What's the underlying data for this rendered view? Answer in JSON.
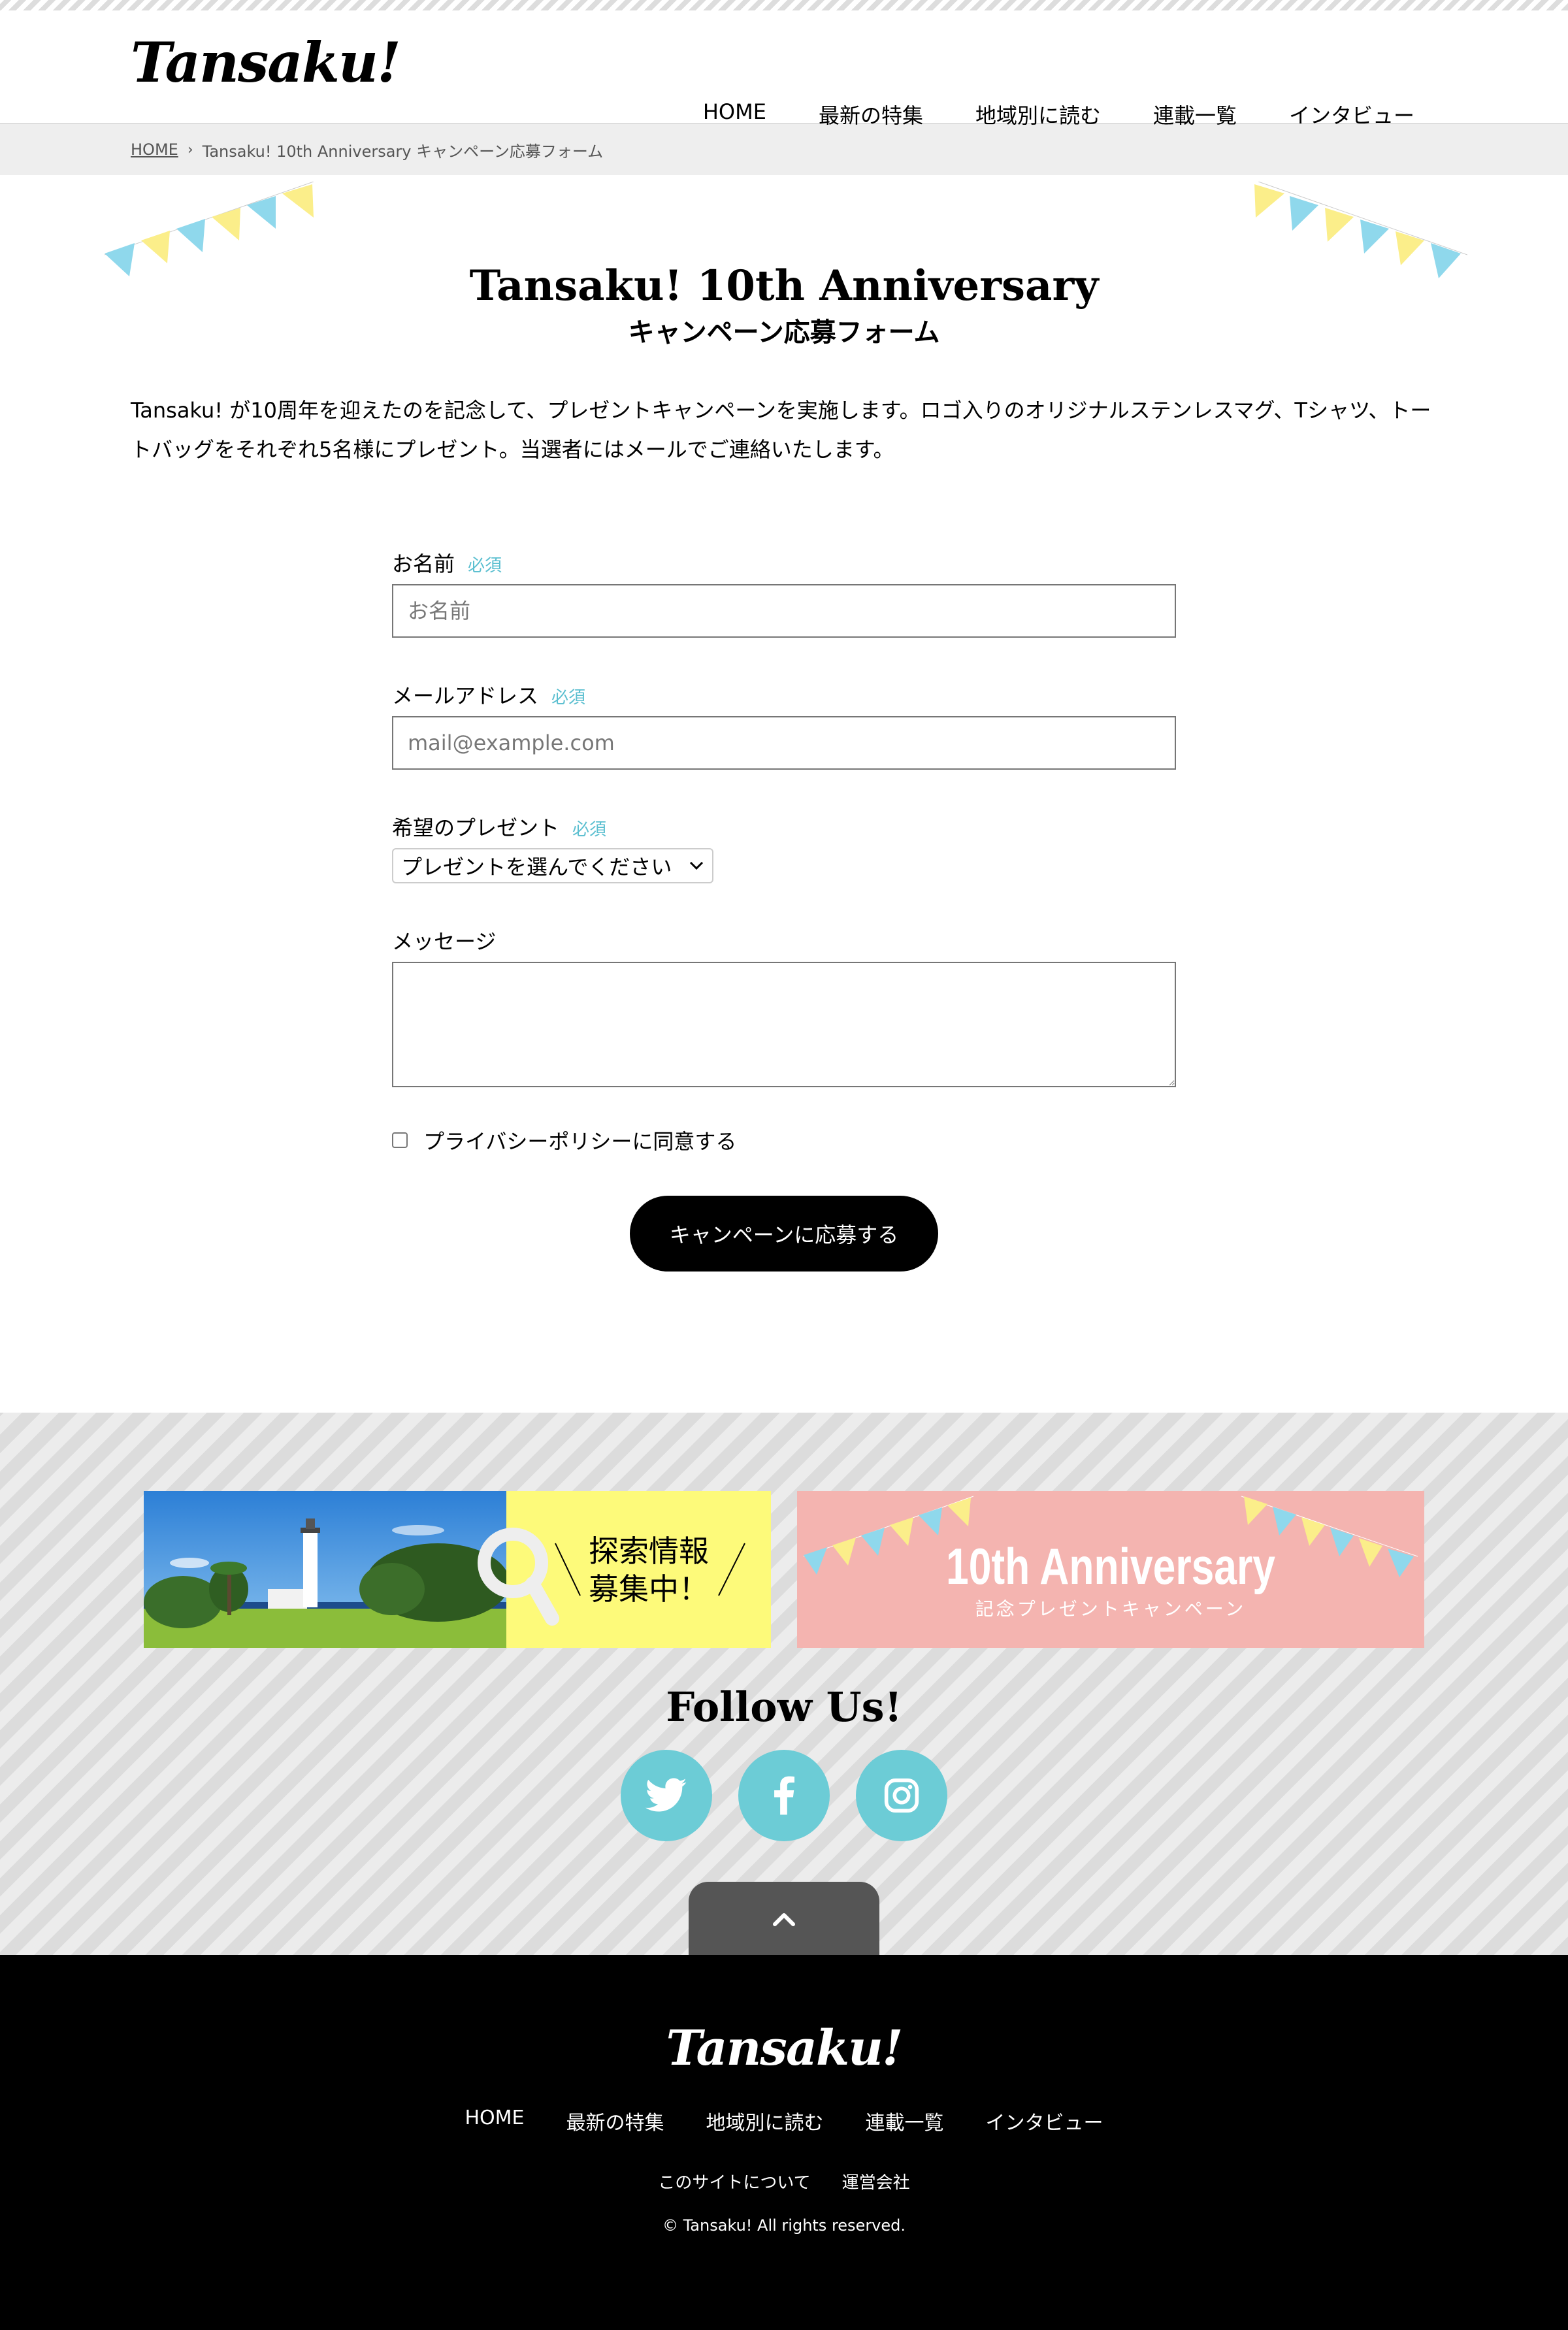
{
  "site": {
    "logo": "Tansaku!"
  },
  "nav": [
    {
      "label": "HOME"
    },
    {
      "label": "最新の特集"
    },
    {
      "label": "地域別に読む"
    },
    {
      "label": "連載一覧"
    },
    {
      "label": "インタビュー"
    }
  ],
  "breadcrumb": {
    "home": "HOME",
    "current": "Tansaku! 10th Anniversary キャンペーン応募フォーム"
  },
  "hero": {
    "title": "Tansaku! 10th Anniversary",
    "subtitle": "キャンペーン応募フォーム"
  },
  "intro": {
    "text": "Tansaku! が10周年を迎えたのを記念して、プレゼントキャンペーンを実施します。ロゴ入りのオリジナルステンレスマグ、Tシャツ、トートバッグをそれぞれ5名様にプレゼント。当選者にはメールでご連絡いたします。"
  },
  "form": {
    "name_label": "お名前",
    "name_required": "必須",
    "name_placeholder": "お名前",
    "email_label": "メールアドレス",
    "email_required": "必須",
    "email_placeholder": "mail@example.com",
    "present_label": "希望のプレゼント",
    "present_required": "必須",
    "present_value": "プレゼントを選んでください",
    "message_label": "メッセージ",
    "privacy_label": "プライバシーポリシーに同意する",
    "submit_label": "キャンペーンに応募する"
  },
  "banners": {
    "banner1_text_line1": "探索情報",
    "banner1_text_line2": "募集中！",
    "banner2_title": "10th Anniversary",
    "banner2_subtitle": "記念プレゼントキャンペーン"
  },
  "follow": {
    "title": "Follow Us!",
    "icons": [
      "twitter-icon",
      "facebook-icon",
      "instagram-icon"
    ]
  },
  "footer": {
    "logo": "Tansaku!",
    "nav": [
      {
        "label": "HOME"
      },
      {
        "label": "最新の特集"
      },
      {
        "label": "地域別に読む"
      },
      {
        "label": "連載一覧"
      },
      {
        "label": "インタビュー"
      }
    ],
    "subnav": [
      {
        "label": "このサイトについて"
      },
      {
        "label": "運営会社"
      }
    ],
    "copyright": "© Tansaku! All rights reserved."
  },
  "colors": {
    "accent": "#6cccd6",
    "required": "#5bbfd0",
    "bunting_blue": "#8fd8ec",
    "bunting_yellow": "#fbee8a",
    "banner_pink": "#f4b4b0",
    "banner_yellow": "#fdfa7a"
  }
}
